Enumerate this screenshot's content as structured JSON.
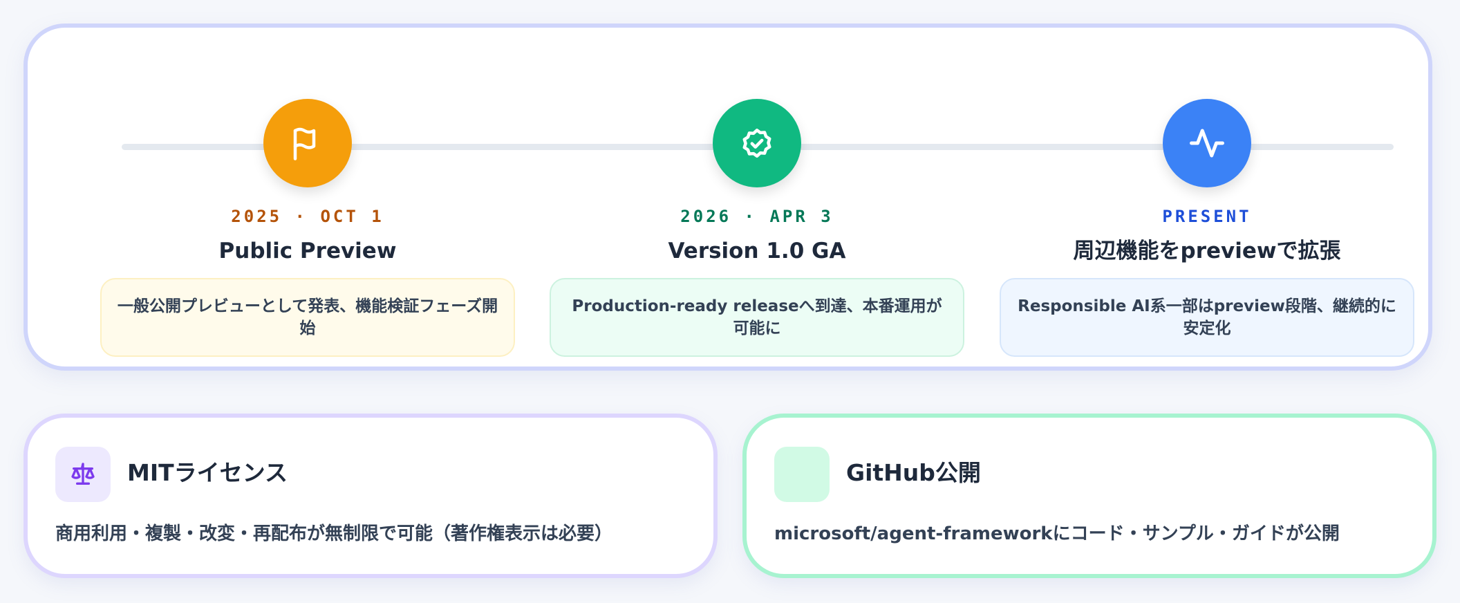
{
  "timeline": {
    "milestones": [
      {
        "date": "2025 · OCT 1",
        "title": "Public Preview",
        "description": "一般公開プレビューとして発表、機能検証フェーズ開始",
        "icon": "flag-icon",
        "color": "#f59e0b"
      },
      {
        "date": "2026 · APR 3",
        "title": "Version 1.0 GA",
        "description": "Production-ready releaseへ到達、本番運用が可能に",
        "icon": "badge-check-icon",
        "color": "#10b981"
      },
      {
        "date": "PRESENT",
        "title": "周辺機能をpreviewで拡張",
        "description": "Responsible AI系一部はpreview段階、継続的に安定化",
        "icon": "activity-icon",
        "color": "#3b82f6"
      }
    ]
  },
  "cards": [
    {
      "title": "MITライセンス",
      "body": "商用利用・複製・改変・再配布が無制限で可能（著作権表示は必要）",
      "icon": "scale-icon",
      "accent": "#7c3aed"
    },
    {
      "title": "GitHub公開",
      "body": "microsoft/agent-frameworkにコード・サンプル・ガイドが公開",
      "icon": "github-icon",
      "accent": "#10b981"
    }
  ]
}
